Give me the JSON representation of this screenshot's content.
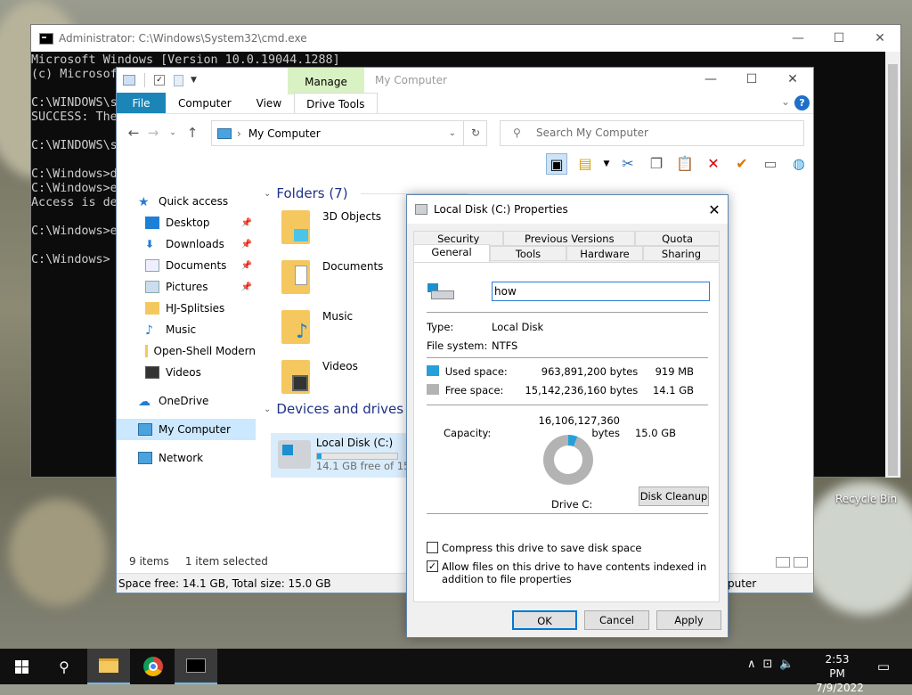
{
  "cmd": {
    "title": "Administrator: C:\\Windows\\System32\\cmd.exe",
    "lines": [
      "Microsoft Windows [Version 10.0.19044.1288]",
      "(c) Microsof",
      "",
      "C:\\WINDOWS\\s",
      "SUCCESS: The",
      "",
      "C:\\WINDOWS\\s",
      "",
      "C:\\Windows>d",
      "C:\\Windows>e",
      "Access is de",
      "",
      "C:\\Windows>e",
      "",
      "C:\\Windows>"
    ]
  },
  "explorer": {
    "title": "My Computer",
    "manage_tab": "Manage",
    "ribbon_tabs": [
      "File",
      "Computer",
      "View",
      "Drive Tools"
    ],
    "address": "My Computer",
    "search_placeholder": "Search My Computer",
    "nav": {
      "quick_access": "Quick access",
      "items": [
        "Desktop",
        "Downloads",
        "Documents",
        "Pictures",
        "HJ-Splitsies",
        "Music",
        "Open-Shell Modern",
        "Videos"
      ],
      "onedrive": "OneDrive",
      "my_computer": "My Computer",
      "network": "Network"
    },
    "folders_header": "Folders (7)",
    "folders": [
      "3D Objects",
      "Documents",
      "Music",
      "Videos"
    ],
    "devices_header": "Devices and drives (2)",
    "drive_name": "Local Disk (C:)",
    "drive_free": "14.1 GB free of 15.",
    "drive_used_fraction": 0.06,
    "status_items": "9 items",
    "status_selected": "1 item selected",
    "status_bar": "Space free: 14.1 GB, Total size: 15.0 GB",
    "status_bar_right": "puter"
  },
  "dialog": {
    "title": "Local Disk (C:) Properties",
    "tabs_row1": [
      "Security",
      "Previous Versions",
      "Quota"
    ],
    "tabs_row2": [
      "General",
      "Tools",
      "Hardware",
      "Sharing"
    ],
    "name_value": "how",
    "type_label": "Type:",
    "type_value": "Local Disk",
    "fs_label": "File system:",
    "fs_value": "NTFS",
    "used_label": "Used space:",
    "used_bytes": "963,891,200 bytes",
    "used_gb": "919 MB",
    "free_label": "Free space:",
    "free_bytes": "15,142,236,160 bytes",
    "free_gb": "14.1 GB",
    "cap_label": "Capacity:",
    "cap_bytes": "16,106,127,360 bytes",
    "cap_gb": "15.0 GB",
    "drive_label": "Drive C:",
    "cleanup": "Disk Cleanup",
    "compress": "Compress this drive to save disk space",
    "index": "Allow files on this drive to have contents indexed in addition to file properties",
    "ok": "OK",
    "cancel": "Cancel",
    "apply": "Apply",
    "used_color": "#26a0da",
    "free_color": "#b3b3b3"
  },
  "desktop": {
    "recycle_bin": "Recycle Bin"
  },
  "taskbar": {
    "time": "2:53 PM",
    "date": "7/9/2022"
  }
}
